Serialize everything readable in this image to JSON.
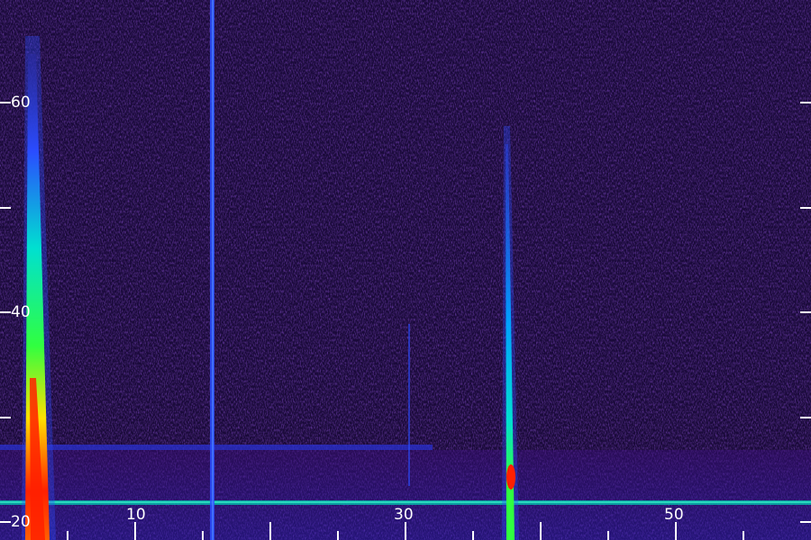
{
  "spectrogram": {
    "y_tick_labels": [
      "60",
      "40",
      "20"
    ],
    "x_tick_labels": [
      "10",
      "30",
      "50"
    ],
    "colors": {
      "background": "#1a0a3a",
      "noise_low": "#2a0a55",
      "noise_mid": "#3a0e7a",
      "blue": "#2a4cff",
      "cyan": "#00e0d0",
      "green": "#30ff40",
      "yellow": "#ffe000",
      "red": "#ff2000",
      "axis": "#ffffff"
    }
  }
}
